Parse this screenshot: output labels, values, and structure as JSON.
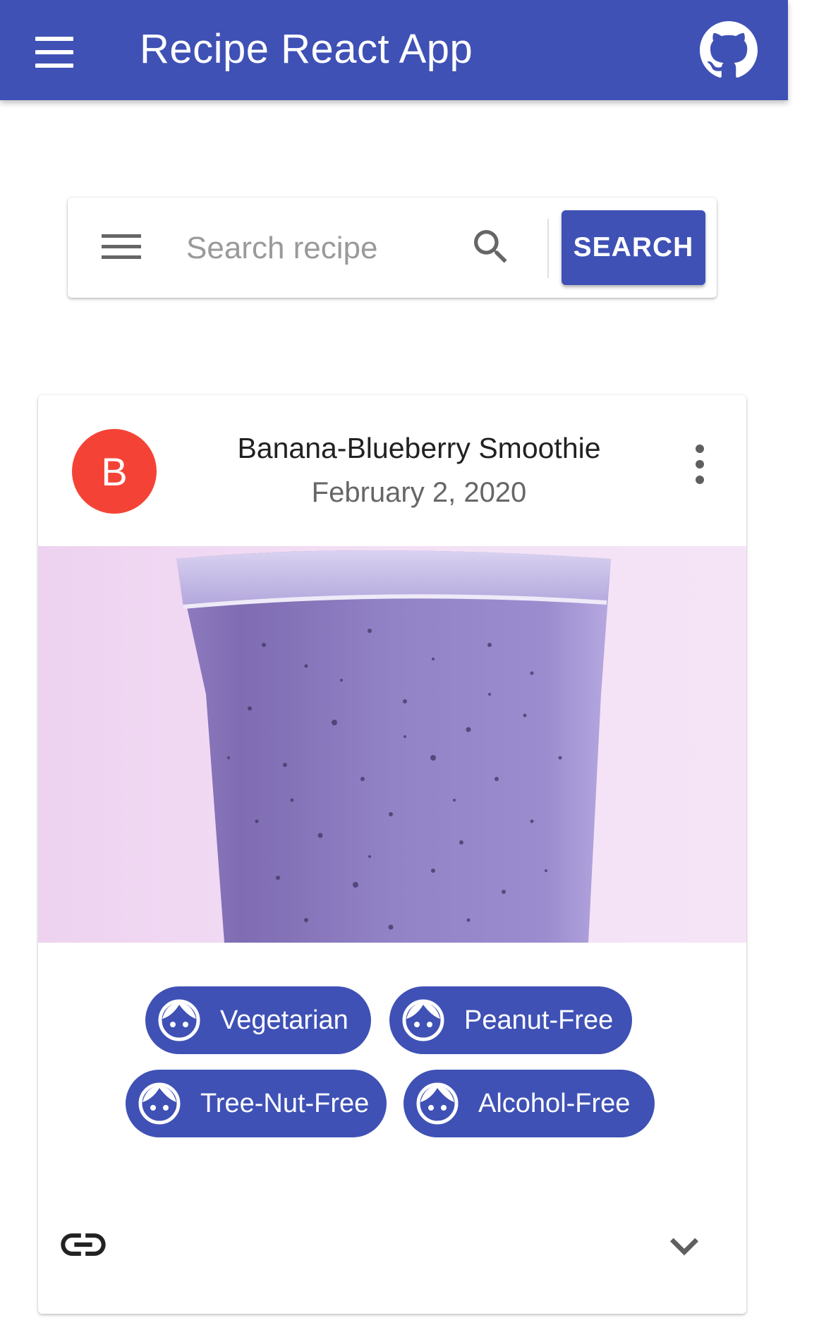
{
  "appbar": {
    "title": "Recipe React App",
    "color": "#3f51b5",
    "icons": [
      "menu-icon",
      "github-icon"
    ]
  },
  "search": {
    "placeholder": "Search recipe",
    "value": "",
    "button_label": "SEARCH",
    "icons": [
      "menu-icon",
      "search-icon"
    ]
  },
  "card": {
    "avatar_letter": "B",
    "avatar_color": "#f44336",
    "title": "Banana-Blueberry Smoothie",
    "date": "February 2, 2020",
    "image_alt": "Banana-Blueberry Smoothie",
    "labels": [
      {
        "label": "Vegetarian",
        "icon": "face-icon"
      },
      {
        "label": "Peanut-Free",
        "icon": "face-icon"
      },
      {
        "label": "Tree-Nut-Free",
        "icon": "face-icon"
      },
      {
        "label": "Alcohol-Free",
        "icon": "face-icon"
      }
    ],
    "chip_color": "#3f51b5",
    "actions": [
      "link-icon",
      "expand-more-icon"
    ]
  }
}
